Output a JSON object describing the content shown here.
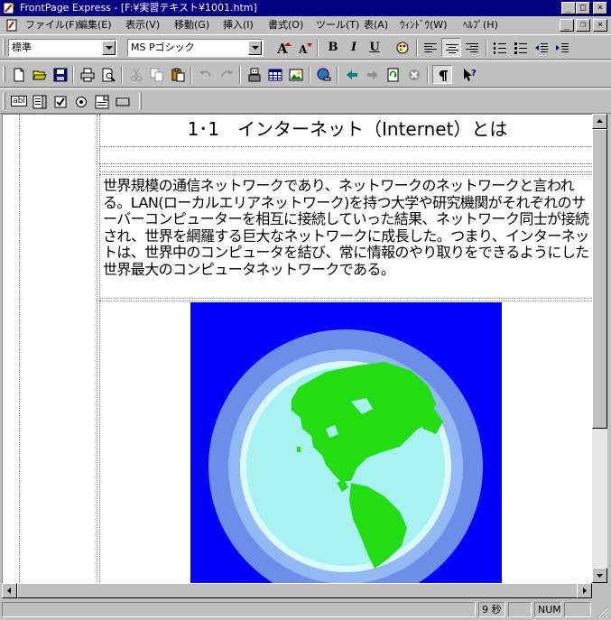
{
  "window": {
    "title": "FrontPage Express - [F:¥実習テキスト¥1001.htm]",
    "caption_minimize": "_",
    "caption_maximize": "□",
    "caption_close": "×"
  },
  "menu": {
    "items": [
      "ファイル(F)",
      "編集(E)",
      "表示(V)",
      "移動(G)",
      "挿入(I)",
      "書式(O)",
      "ツール(T)",
      "表(A)",
      "ｳｨﾝﾄﾞｳ(W)",
      "ﾍﾙﾌﾟ(H)"
    ],
    "mdi_minimize": "_",
    "mdi_restore": "❐",
    "mdi_close": "×"
  },
  "format_toolbar": {
    "style_value": "標準",
    "font_value": "MS Pゴシック",
    "bold": "B",
    "italic": "I",
    "underline": "U"
  },
  "form_toolbar": {
    "textbox_label": "abl"
  },
  "document": {
    "heading": "1･1　インターネット（Internet）とは",
    "paragraph": "世界規模の通信ネットワークであり、ネットワークのネットワークと言われる。LAN(ローカルエリアネットワーク)を持つ大学や研究機関がそれぞれのサーバーコンピューターを相互に接続していった結果、ネットワーク同士が接続され、世界を網羅する巨大なネットワークに成長した。つまり、インターネットは、世界中のコンピュータを結び、常に情報のやり取りをできるようにした世界最大のコンピュータネットワークである。"
  },
  "status": {
    "time": "9 秒",
    "num": "NUM"
  },
  "colors": {
    "titlebar": "#000080",
    "globe_bg": "#0000ff",
    "globe_ring": "#6b8fe8",
    "ocean": "#a9f2f2",
    "land": "#22dd11"
  }
}
